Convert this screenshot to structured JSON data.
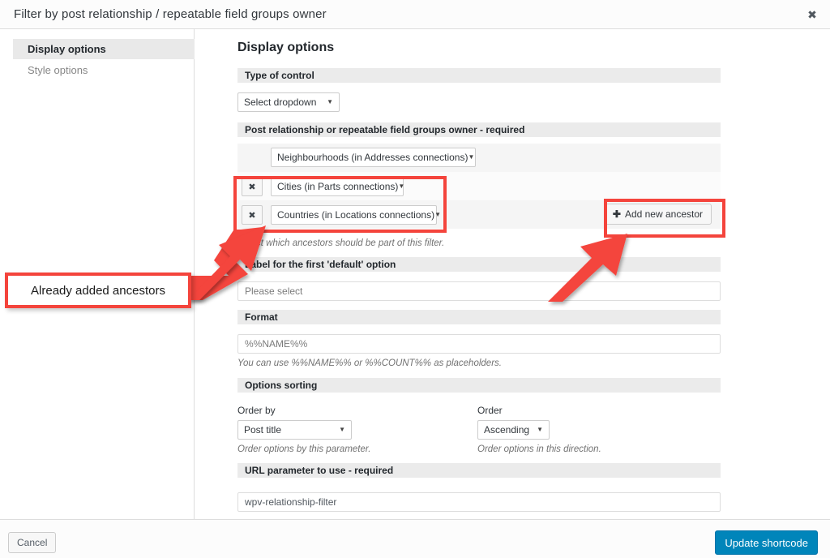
{
  "window": {
    "title": "Filter by post relationship / repeatable field groups owner",
    "close_label": "✖"
  },
  "sidebar": {
    "items": [
      {
        "label": "Display options",
        "active": true
      },
      {
        "label": "Style options",
        "active": false
      }
    ]
  },
  "main": {
    "title": "Display options",
    "sections": {
      "type_of_control": {
        "header": "Type of control",
        "select_value": "Select dropdown"
      },
      "owner": {
        "header": "Post relationship or repeatable field groups owner - required",
        "ancestors": [
          {
            "value": "Neighbourhoods (in Addresses connections)",
            "deletable": false,
            "delete_label": ""
          },
          {
            "value": "Cities (in Parts connections)",
            "deletable": true,
            "delete_label": "✖"
          },
          {
            "value": "Countries (in Locations connections)",
            "deletable": true,
            "delete_label": "✖"
          }
        ],
        "add_button_label": "Add new ancestor",
        "add_button_icon": "plus-icon",
        "help": "Select which ancestors should be part of this filter."
      },
      "default_option": {
        "header": "Label for the first 'default' option",
        "input_value": "Please select",
        "input_placeholder": "Please select"
      },
      "format": {
        "header": "Format",
        "input_value": "%%NAME%%",
        "input_placeholder": "%%NAME%%",
        "help": "You can use %%NAME%% or %%COUNT%% as placeholders."
      },
      "options_sorting": {
        "header": "Options sorting",
        "order_by_label": "Order by",
        "order_by_value": "Post title",
        "order_by_help": "Order options by this parameter.",
        "order_label": "Order",
        "order_value": "Ascending",
        "order_help": "Order options in this direction."
      },
      "url_parameter": {
        "header": "URL parameter to use - required",
        "input_value": "wpv-relationship-filter",
        "input_placeholder": "wpv-relationship-filter"
      }
    }
  },
  "footer": {
    "cancel_label": "Cancel",
    "primary_label": "Update shortcode"
  },
  "annotations": {
    "callout_text": "Already added ancestors",
    "accent_color": "#f4443c"
  },
  "colors": {
    "primary_button": "#0085ba",
    "section_bar": "#ebebeb",
    "sidebar_active": "#e9e9e9",
    "annotation_red": "#f4443c"
  }
}
